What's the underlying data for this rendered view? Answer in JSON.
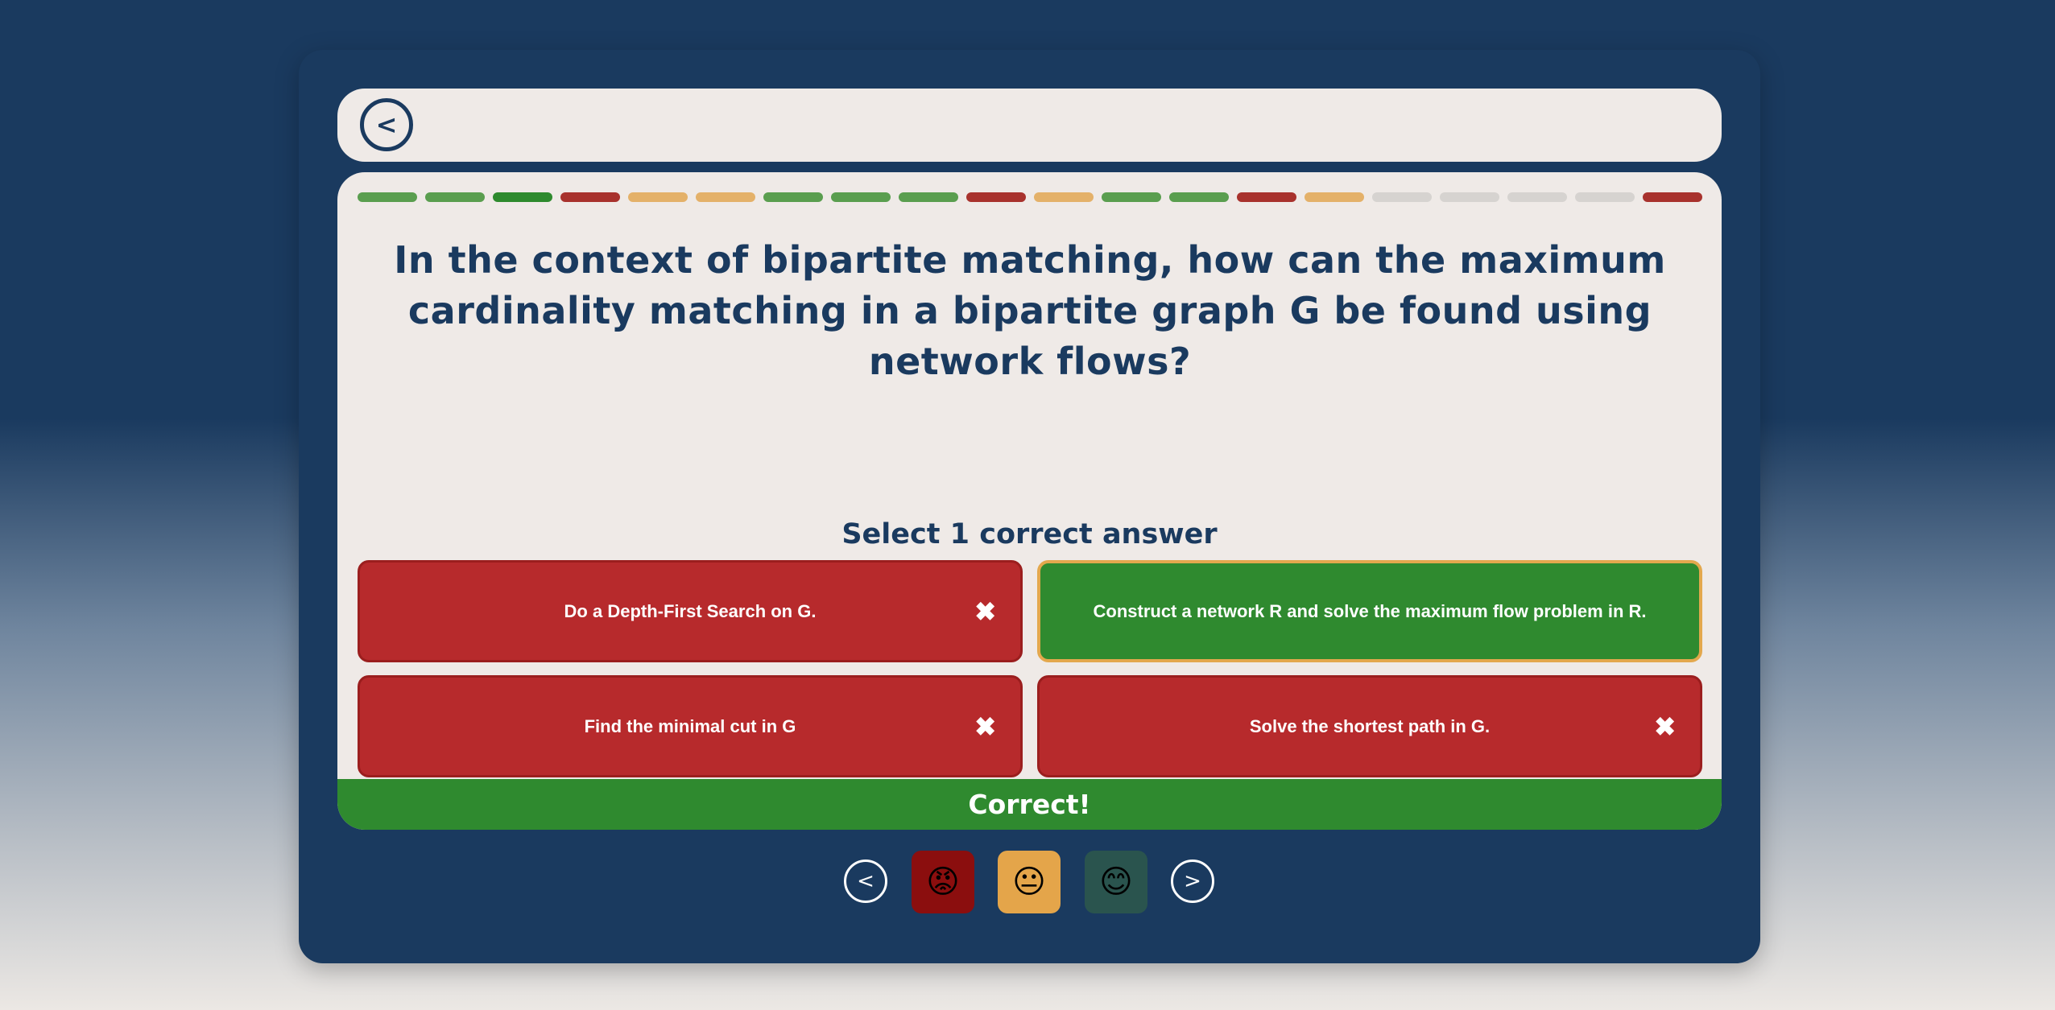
{
  "header": {
    "back_label": "<"
  },
  "progress": {
    "segments": [
      "green",
      "green",
      "darkgreen",
      "red",
      "orange",
      "orange",
      "green",
      "green",
      "green",
      "red",
      "orange",
      "green",
      "green",
      "red",
      "orange",
      "gray",
      "gray",
      "gray",
      "gray",
      "red"
    ]
  },
  "colors": {
    "green": "#5a9e4f",
    "darkgreen": "#2e8a2e",
    "red": "#a8322d",
    "orange": "#e4b169",
    "gray": "#d6d3d0"
  },
  "question": {
    "text": "In the context of bipartite matching, how can the maximum cardinality matching in a bipartite graph G be found using network flows?",
    "instruction": "Select 1 correct answer"
  },
  "answers": [
    {
      "text": "Do a Depth-First Search on G.",
      "status": "wrong",
      "mark": "✖"
    },
    {
      "text": "Construct a network R and solve the maximum flow problem in R.",
      "status": "correct",
      "mark": ""
    },
    {
      "text": "Find the minimal cut in G",
      "status": "wrong",
      "mark": "✖"
    },
    {
      "text": "Solve the shortest path in G.",
      "status": "wrong",
      "mark": "✖"
    }
  ],
  "result": {
    "text": "Correct!"
  },
  "footer": {
    "prev_label": "<",
    "next_label": ">",
    "ratings": [
      {
        "icon": "angry-face-icon",
        "glyph": "😡",
        "bg": "#8b0e0e"
      },
      {
        "icon": "neutral-face-icon",
        "glyph": "😐",
        "bg": "#e4a54a"
      },
      {
        "icon": "smiling-face-icon",
        "glyph": "😊",
        "bg": "#2a544e"
      }
    ]
  }
}
